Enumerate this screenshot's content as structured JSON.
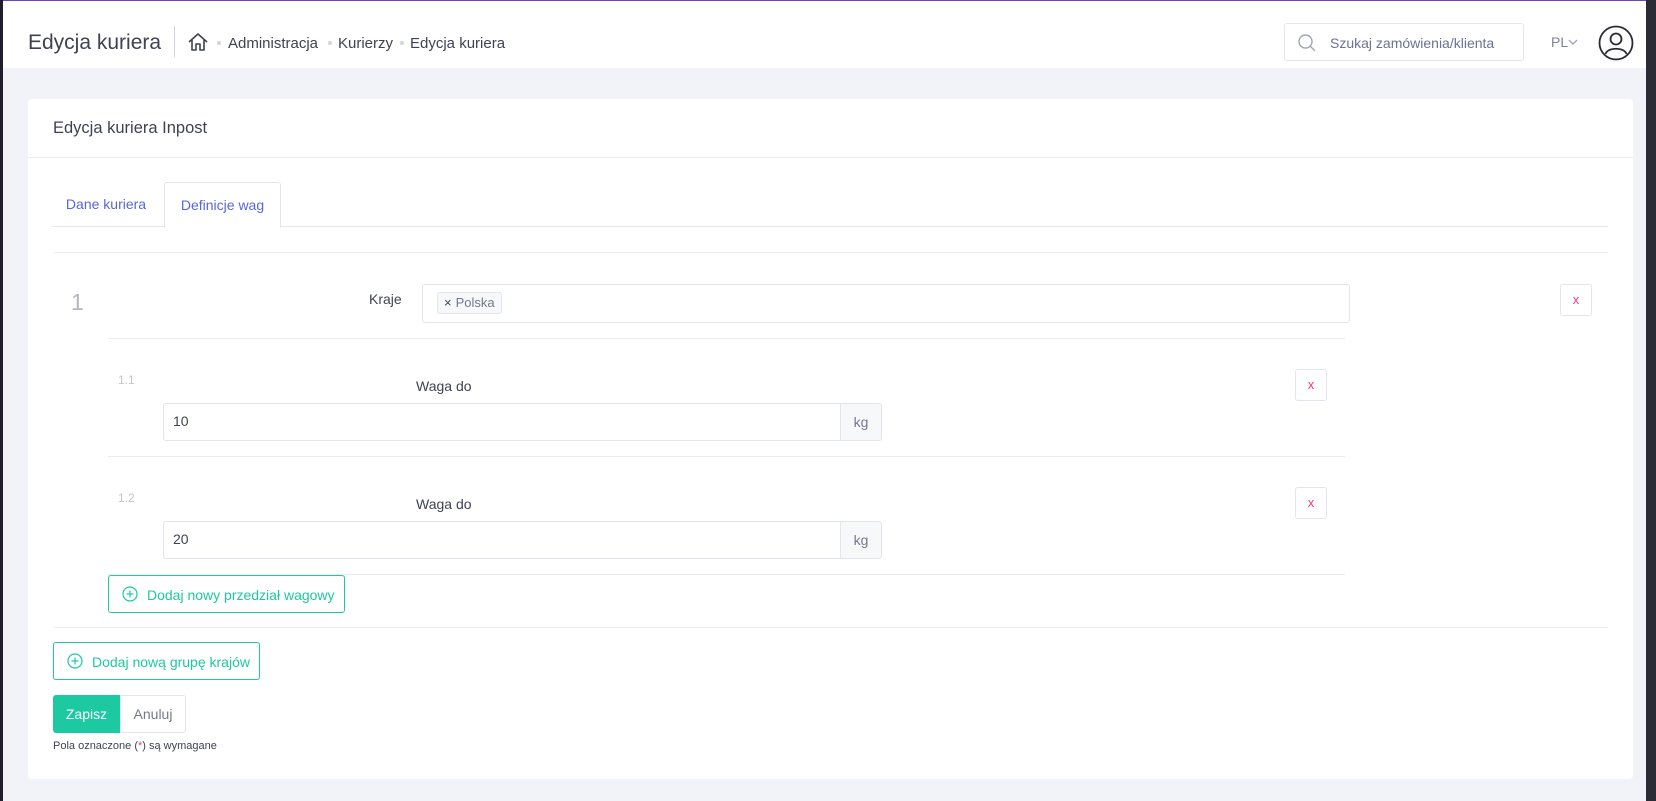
{
  "header": {
    "title": "Edycja kuriera",
    "breadcrumbs": [
      "Administracja",
      "Kurierzy",
      "Edycja kuriera"
    ],
    "search_placeholder": "Szukaj zamówienia/klienta",
    "language": "PL"
  },
  "card": {
    "title": "Edycja kuriera Inpost",
    "tabs": [
      {
        "label": "Dane kuriera",
        "active": false
      },
      {
        "label": "Definicje wag",
        "active": true
      }
    ],
    "group": {
      "number": "1",
      "countries_label": "Kraje",
      "countries": [
        "Polska"
      ],
      "delete_label": "x",
      "weight_ranges": [
        {
          "number": "1.1",
          "label": "Waga do",
          "value": "10",
          "unit": "kg",
          "delete_label": "x"
        },
        {
          "number": "1.2",
          "label": "Waga do",
          "value": "20",
          "unit": "kg",
          "delete_label": "x"
        }
      ],
      "add_range_label": "Dodaj nowy przedział wagowy"
    },
    "add_group_label": "Dodaj nową grupę krajów",
    "save_label": "Zapisz",
    "cancel_label": "Anuluj",
    "required_note": {
      "prefix": "Pola oznaczone (",
      "star": "*",
      "suffix": ") są wymagane"
    }
  },
  "colors": {
    "accent": "#5867dd",
    "success": "#1dc9a0",
    "danger": "#fd397a"
  }
}
